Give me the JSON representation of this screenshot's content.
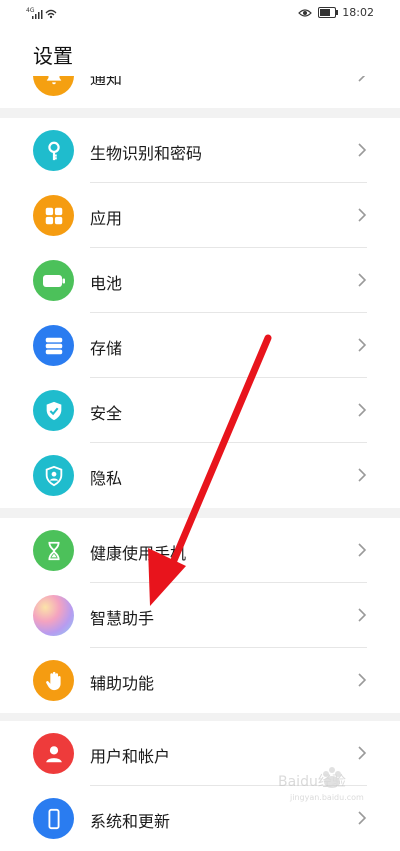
{
  "status_bar": {
    "signal_label": "4G",
    "time": "18:02",
    "battery_level": 0.7
  },
  "header": {
    "title": "设置"
  },
  "partial_item": {
    "label": "通知",
    "icon": "bell-icon",
    "color": "#f5a011"
  },
  "groups": [
    {
      "items": [
        {
          "label": "生物识别和密码",
          "icon": "key-icon",
          "color": "#1fbccd"
        },
        {
          "label": "应用",
          "icon": "apps-icon",
          "color": "#f59c11"
        },
        {
          "label": "电池",
          "icon": "battery-icon",
          "color": "#4cc15a"
        },
        {
          "label": "存储",
          "icon": "storage-icon",
          "color": "#2a7cf0"
        },
        {
          "label": "安全",
          "icon": "shield-check-icon",
          "color": "#1fbccd"
        },
        {
          "label": "隐私",
          "icon": "privacy-icon",
          "color": "#1fbccd"
        }
      ]
    },
    {
      "items": [
        {
          "label": "健康使用手机",
          "icon": "hourglass-icon",
          "color": "#4cc15a"
        },
        {
          "label": "智慧助手",
          "icon": "assistant-icon",
          "color": "#c9a6ef"
        },
        {
          "label": "辅助功能",
          "icon": "hand-icon",
          "color": "#f59c11"
        }
      ]
    },
    {
      "items": [
        {
          "label": "用户和帐户",
          "icon": "user-icon",
          "color": "#ee3b3b"
        },
        {
          "label": "系统和更新",
          "icon": "phone-icon",
          "color": "#2a7cf0"
        }
      ]
    }
  ],
  "annotation": {
    "arrow_color": "#e8141c"
  },
  "watermark": {
    "text": "Baidu经验",
    "subtext": "jingyan.baidu.com"
  }
}
